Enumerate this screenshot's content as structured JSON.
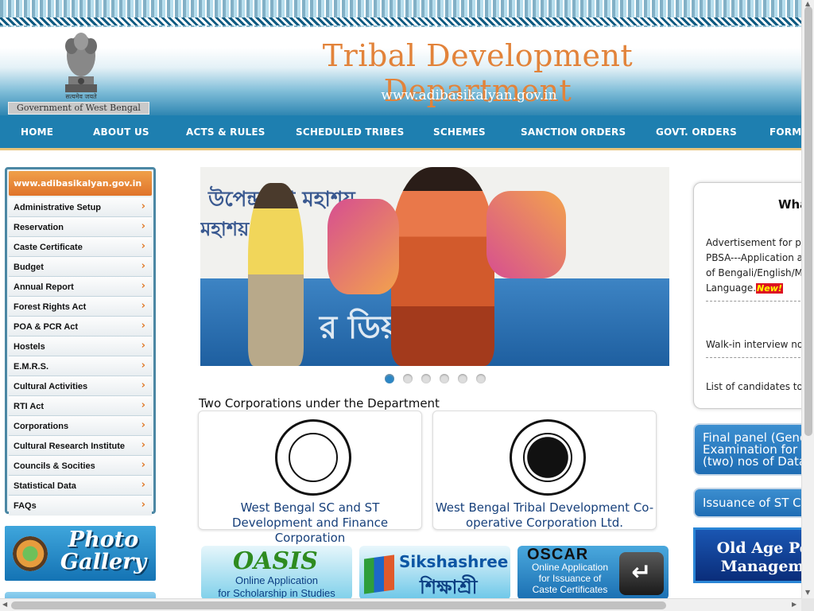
{
  "header": {
    "title": "Tribal Development Department",
    "url": "www.adibasikalyan.gov.in",
    "emblem_motto": "सत्यमेव जयते",
    "gov_label": "Government of West Bengal"
  },
  "nav": {
    "items": [
      "HOME",
      "ABOUT US",
      "ACTS & RULES",
      "SCHEDULED TRIBES",
      "SCHEMES",
      "SANCTION ORDERS",
      "GOVT. ORDERS",
      "FORMS"
    ]
  },
  "sidebar": {
    "heading": "www.adibasikalyan.gov.in",
    "items": [
      {
        "label": "Administrative Setup"
      },
      {
        "label": "Reservation"
      },
      {
        "label": "Caste Certificate"
      },
      {
        "label": "Budget"
      },
      {
        "label": "Annual Report"
      },
      {
        "label": "Forest Rights Act"
      },
      {
        "label": "POA & PCR Act"
      },
      {
        "label": "Hostels"
      },
      {
        "label": "E.M.R.S."
      },
      {
        "label": "Cultural Activities"
      },
      {
        "label": "RTI Act"
      },
      {
        "label": "Corporations"
      },
      {
        "label": "Cultural Research Institute"
      },
      {
        "label": "Councils & Socities"
      },
      {
        "label": "Statistical Data"
      },
      {
        "label": "FAQs"
      }
    ],
    "chevron_icon": "chevron-right-icon",
    "photo_gallery": "Photo Gallery"
  },
  "slider": {
    "banner_text_1": "উপেন্দ্রনাথ মহাশয়",
    "banner_text_2": "মহাশয়, মা",
    "banner_text_3": "য়",
    "band_text": "র  ডিয়া  কাতা",
    "dots_total": 6,
    "active_dot": 1
  },
  "corporations": {
    "heading": "Two Corporations under the Department",
    "cards": [
      {
        "name": "West Bengal SC and ST Development and Finance Corporation"
      },
      {
        "name": "West Bengal Tribal Development Co-operative Corporation Ltd."
      }
    ]
  },
  "banners": {
    "oasis": {
      "logo": "OASIS",
      "line1": "Online Application",
      "line2": "for Scholarship in Studies"
    },
    "sikshashree": {
      "title": "Sikshashree",
      "subtitle": "শিক্ষাশ্রী"
    },
    "oscar": {
      "title": "OSCAR",
      "line1": "Online Application",
      "line2": "for Issuance of",
      "line3": "Caste Certificates",
      "key_icon": "enter-key-icon"
    }
  },
  "whats_new": {
    "title": "Wha",
    "items": [
      {
        "lines": [
          "Advertisement for pa",
          "PBSA---Application ar",
          "of Bengali/English/Ma",
          "Language."
        ],
        "badge": "New!"
      },
      {
        "lines": [
          "Walk-in interview not"
        ]
      },
      {
        "lines": [
          "List of candidates to b"
        ]
      }
    ]
  },
  "right_boxes": {
    "panel": [
      "Final panel (Gene",
      "Examination for t",
      "(two) nos of Data"
    ],
    "issuance": "Issuance of ST Ce",
    "old_age": [
      "Old Age Pens",
      "Managemen"
    ]
  },
  "colors": {
    "title_orange": "#e2833a",
    "nav_blue": "#1e7fb0",
    "sidebar_header": "#e0742b",
    "corp_text": "#17407b"
  }
}
